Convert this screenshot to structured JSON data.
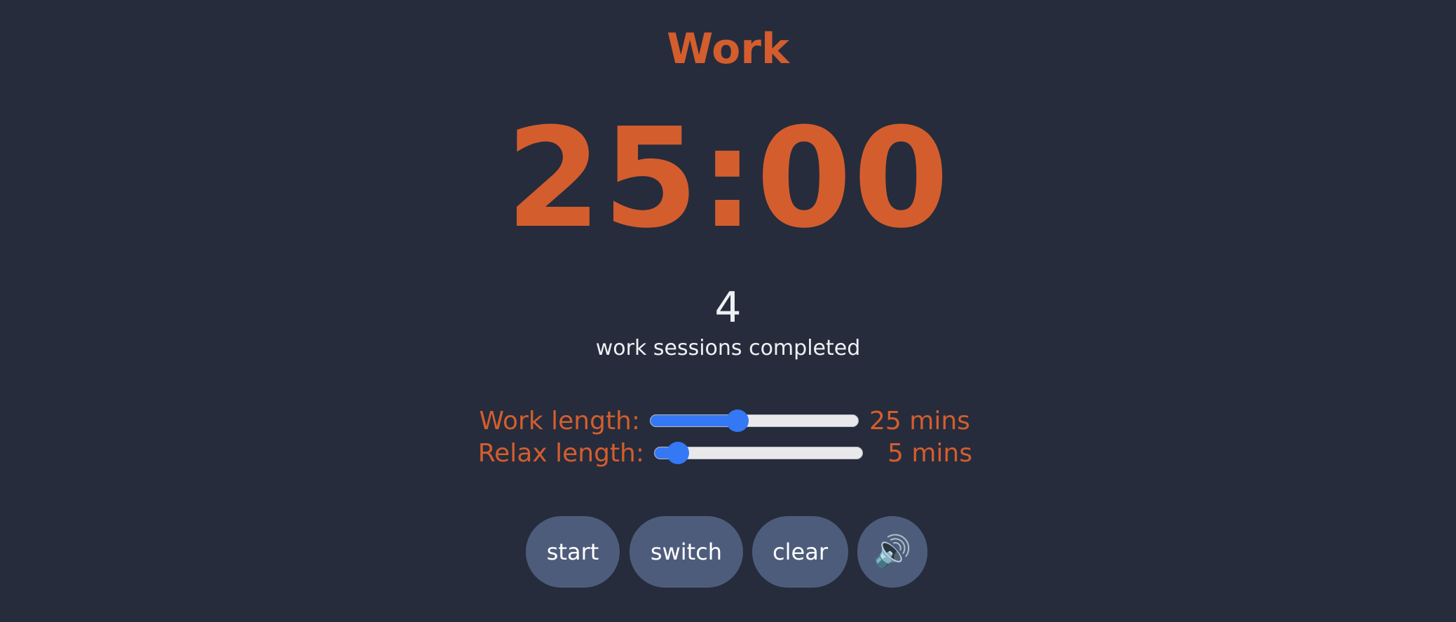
{
  "mode": {
    "title": "Work"
  },
  "timer": {
    "display": "25:00"
  },
  "sessions": {
    "count": "4",
    "label": "work sessions completed"
  },
  "settings": {
    "work": {
      "label": "Work length:",
      "value_text": "25 mins",
      "minutes": 25,
      "fraction": 0.42
    },
    "relax": {
      "label": "Relax length:",
      "value_text": "5 mins",
      "minutes": 5,
      "fraction": 0.11
    }
  },
  "controls": {
    "start_label": "start",
    "switch_label": "switch",
    "clear_label": "clear",
    "sound_icon": "speaker-icon",
    "sound_glyph": "🔊"
  },
  "colors": {
    "background": "#262c3b",
    "accent": "#d45d2e",
    "slider": "#3478f6",
    "button": "#4e5c7c"
  }
}
